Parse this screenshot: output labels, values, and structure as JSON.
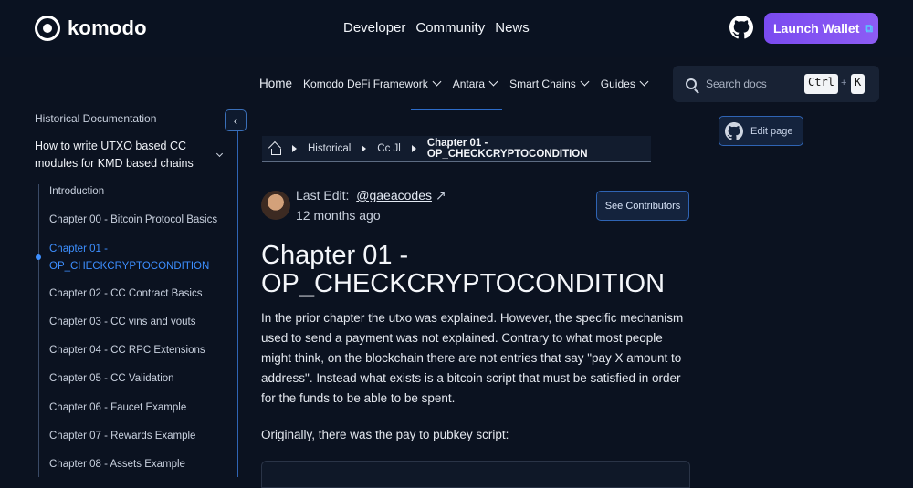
{
  "topbar": {
    "logo_text": "komodo",
    "nav": [
      "Developer",
      "Community",
      "News"
    ],
    "launch_label": "Launch Wallet"
  },
  "subnav": {
    "home": "Home",
    "items": [
      "Komodo DeFi Framework",
      "Antara",
      "Smart Chains",
      "Guides"
    ]
  },
  "search": {
    "placeholder": "Search docs",
    "key1": "Ctrl",
    "plus": "+",
    "key2": "K"
  },
  "sidebar": {
    "title": "Historical Documentation",
    "group": "How to write UTXO based CC modules for KMD based chains",
    "items": [
      "Introduction",
      "Chapter 00 - Bitcoin Protocol Basics",
      "Chapter 01 - OP_CHECKCRYPTOCONDITION",
      "Chapter 02 - CC Contract Basics",
      "Chapter 03 - CC vins and vouts",
      "Chapter 04 - CC RPC Extensions",
      "Chapter 05 - CC Validation",
      "Chapter 06 - Faucet Example",
      "Chapter 07 - Rewards Example",
      "Chapter 08 - Assets Example"
    ]
  },
  "breadcrumb": {
    "items": [
      "Historical",
      "Cc Jl"
    ],
    "current": "Chapter 01 - OP_CHECKCRYPTOCONDITION"
  },
  "meta": {
    "last_edit_label": "Last Edit:",
    "user": "@gaeacodes",
    "arrow": "↗",
    "ago": "12 months ago",
    "contributors_label": "See Contributors",
    "edit_page_label": "Edit page"
  },
  "content": {
    "title": "Chapter 01 - OP_CHECKCRYPTOCONDITION",
    "paragraph1": "In the prior chapter the utxo was explained. However, the specific mechanism used to send a payment was not explained. Contrary to what most people might think, on the blockchain there are not entries that say \"pay X amount to address\". Instead what exists is a bitcoin script that must be satisfied in order for the funds to be able to be spent.",
    "paragraph2": "Originally, there was the pay to pubkey script:"
  },
  "colors": {
    "accent": "#3d8fff",
    "launch": "#7a4bf0",
    "border": "#2f64b4"
  }
}
